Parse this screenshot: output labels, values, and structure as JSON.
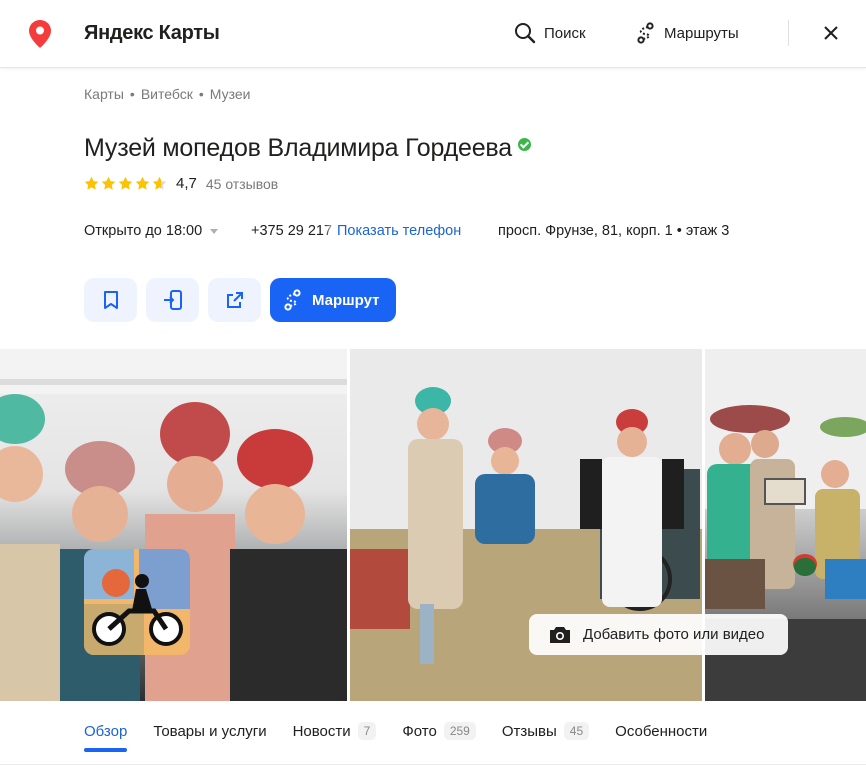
{
  "header": {
    "app_title": "Яндекс Карты",
    "search_label": "Поиск",
    "routes_label": "Маршруты",
    "icons": {
      "logo": "map-pin-icon",
      "search": "search-icon",
      "routes": "routes-icon",
      "close": "close-icon"
    }
  },
  "breadcrumbs": [
    "Карты",
    "Витебск",
    "Музеи"
  ],
  "place": {
    "title": "Музей мопедов Владимира Гордеева",
    "verified": true,
    "rating": "4,7",
    "rating_stars": 4.7,
    "reviews_label": "45 отзывов",
    "hours": "Открыто до 18:00",
    "phone_partial": "+375 29 217",
    "show_phone_label": "Показать телефон",
    "address": "просп. Фрунзе, 81, корп. 1 • этаж 3"
  },
  "actions": {
    "bookmark_icon": "bookmark-icon",
    "send_to_phone_icon": "send-to-phone-icon",
    "share_icon": "share-icon",
    "route_label": "Маршрут"
  },
  "photos": {
    "add_label": "Добавить фото или видео",
    "count": 3
  },
  "tabs": [
    {
      "label": "Обзор",
      "count": "",
      "active": true
    },
    {
      "label": "Товары и услуги",
      "count": ""
    },
    {
      "label": "Новости",
      "count": "7"
    },
    {
      "label": "Фото",
      "count": "259"
    },
    {
      "label": "Отзывы",
      "count": "45"
    },
    {
      "label": "Особенности",
      "count": ""
    }
  ],
  "colors": {
    "accent": "#1a64f5",
    "star": "#fdc200",
    "verified": "#3bb54a",
    "pin": "#f43c3c"
  }
}
